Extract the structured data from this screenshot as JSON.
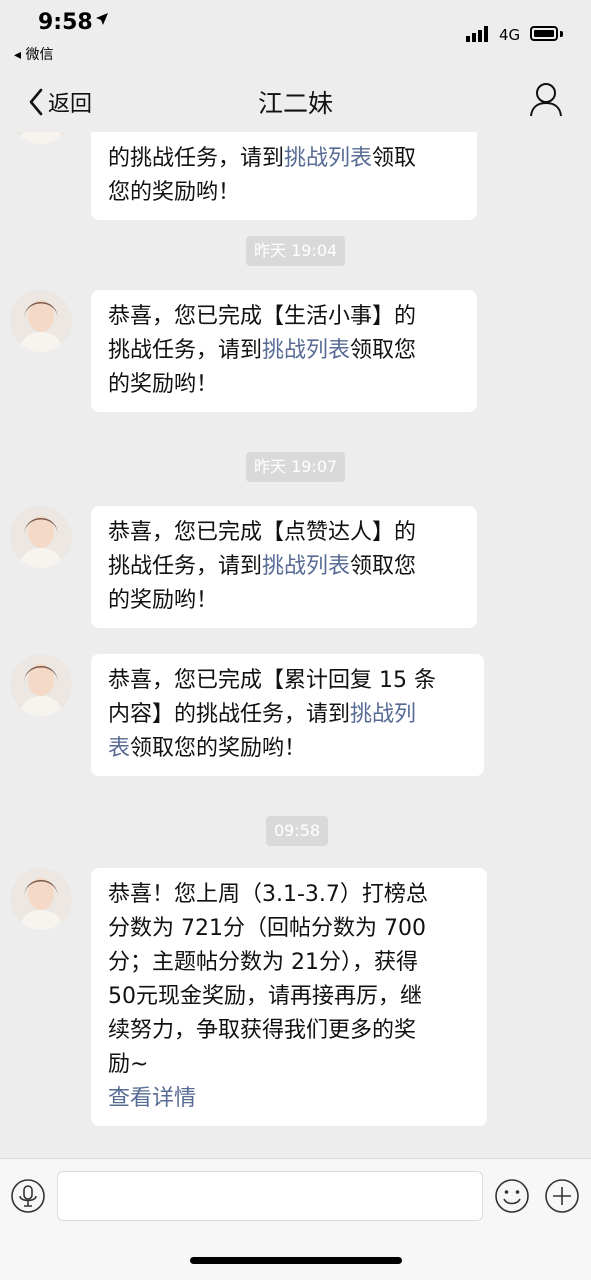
{
  "status_bar": {
    "time": "9:58",
    "back_app": "微信",
    "network": "4G"
  },
  "nav": {
    "back_label": "返回",
    "title": "江二妹"
  },
  "messages": {
    "m0": {
      "line1_pre": "的挑战任务，请到",
      "link": "挑战列表",
      "line1_post": "领取",
      "line2": "您的奖励哟！"
    },
    "t1": "昨天 19:04",
    "m1": {
      "line1": "恭喜，您已完成【生活小事】的",
      "line2_pre": "挑战任务，请到",
      "link": "挑战列表",
      "line2_post": "领取您",
      "line3": "的奖励哟！"
    },
    "t2": "昨天 19:07",
    "m2": {
      "line1": "恭喜，您已完成【点赞达人】的",
      "line2_pre": "挑战任务，请到",
      "link": "挑战列表",
      "line2_post": "领取您",
      "line3": "的奖励哟！"
    },
    "m3": {
      "line1": "恭喜，您已完成【累计回复 15 条",
      "line2_pre": "内容】的挑战任务，请到",
      "link_part1": "挑战列",
      "link_part2": "表",
      "line3_post": "领取您的奖励哟！"
    },
    "t3": "09:58",
    "m4": {
      "line1": "恭喜！您上周（3.1-3.7）打榜总",
      "line2": "分数为 721分（回帖分数为 700",
      "line3": "分；主题帖分数为 21分），获得",
      "line4": "50元现金奖励，请再接再厉，继",
      "line5": "续努力，争取获得我们更多的奖",
      "line6": "励~",
      "link": "查看详情"
    }
  },
  "input": {
    "value": ""
  },
  "colors": {
    "link": "#576b95",
    "background": "#ededed",
    "bubble": "#ffffff"
  }
}
